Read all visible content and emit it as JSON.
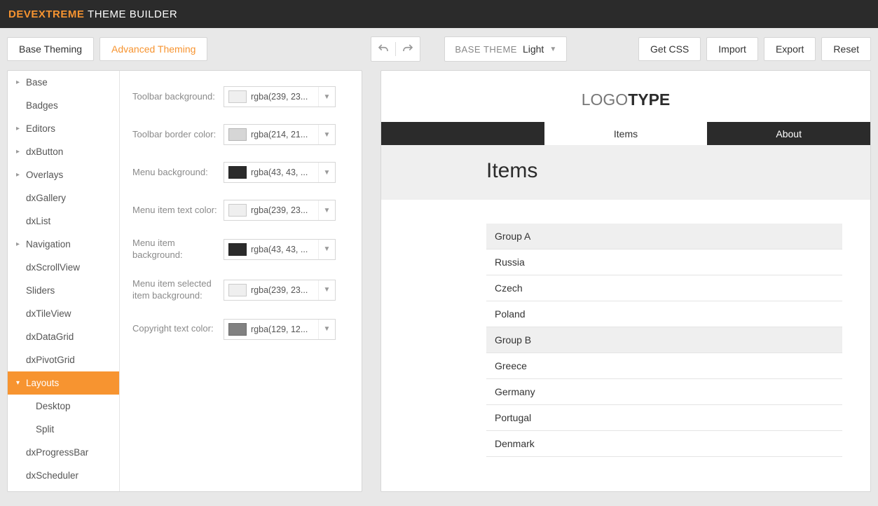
{
  "header": {
    "brand": "DEVEXTREME",
    "sub": "THEME BUILDER"
  },
  "toolbar": {
    "base_theming": "Base Theming",
    "advanced_theming": "Advanced Theming",
    "base_theme_label": "BASE THEME",
    "base_theme_value": "Light",
    "get_css": "Get CSS",
    "import": "Import",
    "export": "Export",
    "reset": "Reset"
  },
  "sidebar": {
    "items": [
      {
        "label": "Base",
        "caret": true
      },
      {
        "label": "Badges"
      },
      {
        "label": "Editors",
        "caret": true
      },
      {
        "label": "dxButton",
        "caret": true
      },
      {
        "label": "Overlays",
        "caret": true
      },
      {
        "label": "dxGallery"
      },
      {
        "label": "dxList"
      },
      {
        "label": "Navigation",
        "caret": true
      },
      {
        "label": "dxScrollView"
      },
      {
        "label": "Sliders"
      },
      {
        "label": "dxTileView"
      },
      {
        "label": "dxDataGrid"
      },
      {
        "label": "dxPivotGrid"
      },
      {
        "label": "Layouts",
        "caret": true,
        "active": true,
        "expanded": true
      },
      {
        "label": "Desktop",
        "child": true
      },
      {
        "label": "Split",
        "child": true
      },
      {
        "label": "dxProgressBar"
      },
      {
        "label": "dxScheduler"
      }
    ]
  },
  "props": [
    {
      "label": "Toolbar background:",
      "value": "rgba(239, 23...",
      "color": "#efefef"
    },
    {
      "label": "Toolbar border color:",
      "value": "rgba(214, 21...",
      "color": "#d6d6d6"
    },
    {
      "label": "Menu background:",
      "value": "rgba(43, 43, ...",
      "color": "#2b2b2b"
    },
    {
      "label": "Menu item text color:",
      "value": "rgba(239, 23...",
      "color": "#efefef"
    },
    {
      "label": "Menu item background:",
      "value": "rgba(43, 43, ...",
      "color": "#2b2b2b"
    },
    {
      "label": "Menu item selected item background:",
      "value": "rgba(239, 23...",
      "color": "#efefef"
    },
    {
      "label": "Copyright text color:",
      "value": "rgba(129, 12...",
      "color": "#818181"
    }
  ],
  "preview": {
    "logo_light": "LOGO",
    "logo_bold": "TYPE",
    "tabs": [
      {
        "label": ""
      },
      {
        "label": "Items",
        "active": true
      },
      {
        "label": "About"
      }
    ],
    "heading": "Items",
    "list": [
      {
        "label": "Group A",
        "header": true
      },
      {
        "label": "Russia"
      },
      {
        "label": "Czech"
      },
      {
        "label": "Poland"
      },
      {
        "label": "Group B",
        "header": true
      },
      {
        "label": "Greece"
      },
      {
        "label": "Germany"
      },
      {
        "label": "Portugal"
      },
      {
        "label": "Denmark"
      }
    ]
  }
}
